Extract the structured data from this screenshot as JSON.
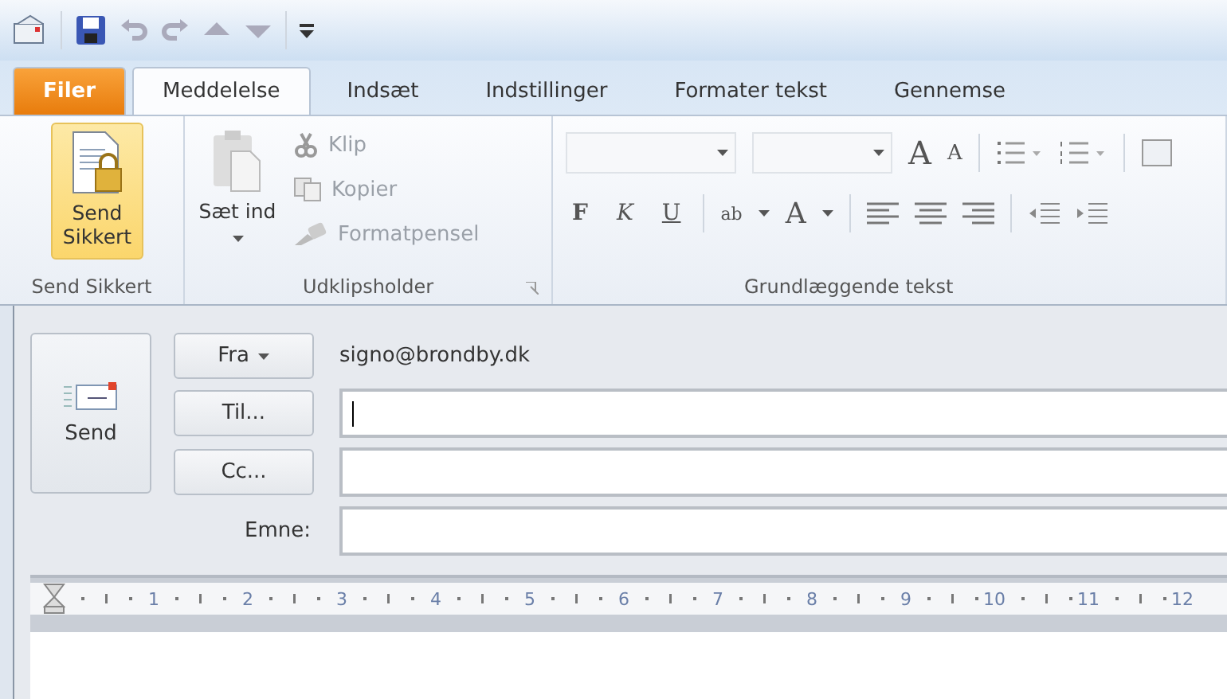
{
  "tabs": [
    {
      "label": "Filer",
      "kind": "file",
      "selected": false
    },
    {
      "label": "Meddelelse",
      "kind": "tab",
      "selected": true
    },
    {
      "label": "Indsæt",
      "kind": "tab",
      "selected": false
    },
    {
      "label": "Indstillinger",
      "kind": "tab",
      "selected": false
    },
    {
      "label": "Formater tekst",
      "kind": "tab",
      "selected": false
    },
    {
      "label": "Gennemse",
      "kind": "tab",
      "selected": false
    }
  ],
  "send_secure": {
    "button": "Send Sikkert",
    "title": "Send Sikkert"
  },
  "clipboard": {
    "paste": "Sæt ind",
    "title": "Udklipsholder",
    "items": [
      {
        "label": "Klip",
        "kind": "cut",
        "disabled": true
      },
      {
        "label": "Kopier",
        "kind": "copy",
        "disabled": true
      },
      {
        "label": "Formatpensel",
        "kind": "brush",
        "disabled": true
      }
    ]
  },
  "text_group": {
    "title": "Grundlæggende tekst",
    "grow": "A",
    "shrink": "A",
    "styles": [
      {
        "label": "F",
        "kind": "bold"
      },
      {
        "label": "K",
        "kind": "italic"
      },
      {
        "label": "U",
        "kind": "underline"
      }
    ],
    "highlight": "ab",
    "font_color": "A"
  },
  "compose": {
    "send": "Send",
    "from_button": "Fra",
    "from_value": "signo@brondby.dk",
    "to_button": "Til...",
    "cc_button": "Cc...",
    "subject_label": "Emne:"
  },
  "ruler": [
    "1",
    "2",
    "3",
    "4",
    "5",
    "6",
    "7",
    "8",
    "9",
    "10",
    "11",
    "12"
  ]
}
